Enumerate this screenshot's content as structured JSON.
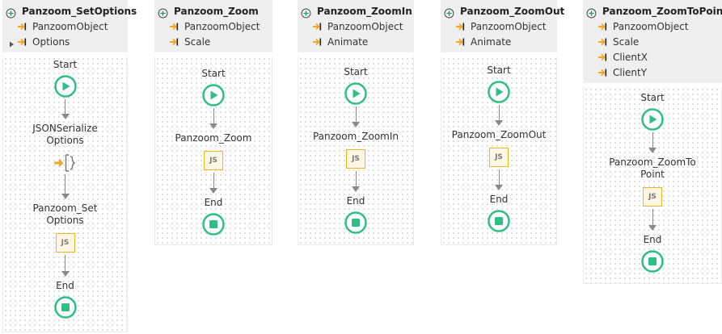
{
  "colors": {
    "start_green": "#2fbf86",
    "end_green": "#2fbf86",
    "js_border": "#f0b429",
    "param_arrow": "#f5a623",
    "header_bg": "#efefef"
  },
  "icons": {
    "action": "client-action-icon",
    "param": "input-parameter-arrow-icon",
    "expand": "expand-triangle-icon"
  },
  "panels": [
    {
      "title": "Panzoom_SetOptions",
      "params": [
        {
          "label": "PanzoomObject",
          "expandable": false
        },
        {
          "label": "Options",
          "expandable": true
        }
      ],
      "flow": {
        "start": "Start",
        "steps": [
          {
            "kind": "serialize",
            "label": "JSONSerialize Options"
          },
          {
            "kind": "js",
            "label": "Panzoom_Set Options",
            "icon_text": "JS"
          }
        ],
        "end": "End"
      }
    },
    {
      "title": "Panzoom_Zoom",
      "params": [
        {
          "label": "PanzoomObject",
          "expandable": false
        },
        {
          "label": "Scale",
          "expandable": false
        }
      ],
      "flow": {
        "start": "Start",
        "steps": [
          {
            "kind": "js",
            "label": "Panzoom_Zoom",
            "icon_text": "JS"
          }
        ],
        "end": "End"
      }
    },
    {
      "title": "Panzoom_ZoomIn",
      "params": [
        {
          "label": "PanzoomObject",
          "expandable": false
        },
        {
          "label": "Animate",
          "expandable": false
        }
      ],
      "flow": {
        "start": "Start",
        "steps": [
          {
            "kind": "js",
            "label": "Panzoom_ZoomIn",
            "icon_text": "JS"
          }
        ],
        "end": "End"
      }
    },
    {
      "title": "Panzoom_ZoomOut",
      "params": [
        {
          "label": "PanzoomObject",
          "expandable": false
        },
        {
          "label": "Animate",
          "expandable": false
        }
      ],
      "flow": {
        "start": "Start",
        "steps": [
          {
            "kind": "js",
            "label": "Panzoom_ZoomOut",
            "icon_text": "JS"
          }
        ],
        "end": "End"
      }
    },
    {
      "title": "Panzoom_ZoomToPoint",
      "params": [
        {
          "label": "PanzoomObject",
          "expandable": false
        },
        {
          "label": "Scale",
          "expandable": false
        },
        {
          "label": "ClientX",
          "expandable": false
        },
        {
          "label": "ClientY",
          "expandable": false
        }
      ],
      "flow": {
        "start": "Start",
        "steps": [
          {
            "kind": "js",
            "label": "Panzoom_ZoomTo Point",
            "icon_text": "JS"
          }
        ],
        "end": "End"
      }
    }
  ]
}
